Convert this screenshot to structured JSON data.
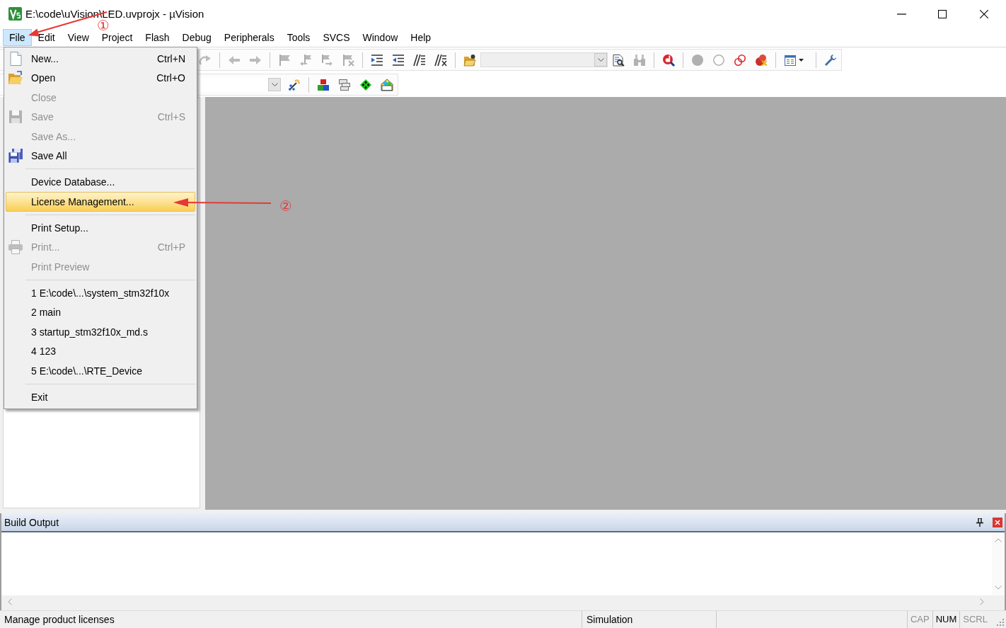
{
  "window": {
    "title": "E:\\code\\uVision\\LED.uvprojx - µVision"
  },
  "menu_bar": [
    {
      "label": "File",
      "selected": true
    },
    {
      "label": "Edit",
      "selected": false
    },
    {
      "label": "View",
      "selected": false
    },
    {
      "label": "Project",
      "selected": false
    },
    {
      "label": "Flash",
      "selected": false
    },
    {
      "label": "Debug",
      "selected": false
    },
    {
      "label": "Peripherals",
      "selected": false
    },
    {
      "label": "Tools",
      "selected": false
    },
    {
      "label": "SVCS",
      "selected": false
    },
    {
      "label": "Window",
      "selected": false
    },
    {
      "label": "Help",
      "selected": false
    }
  ],
  "toolbar_1": [
    {
      "kind": "button",
      "disabled": true
    },
    {
      "kind": "separator"
    },
    {
      "kind": "button",
      "disabled": true
    },
    {
      "kind": "button",
      "disabled": true
    },
    {
      "kind": "separator"
    },
    {
      "kind": "button",
      "disabled": true
    },
    {
      "kind": "button",
      "disabled": true
    },
    {
      "kind": "button",
      "disabled": true
    },
    {
      "kind": "button",
      "disabled": true
    },
    {
      "kind": "separator"
    },
    {
      "kind": "button",
      "disabled": false
    },
    {
      "kind": "button",
      "disabled": false
    },
    {
      "kind": "button",
      "disabled": false
    },
    {
      "kind": "button",
      "disabled": false
    },
    {
      "kind": "separator"
    },
    {
      "kind": "button",
      "disabled": false
    },
    {
      "kind": "combo",
      "disabled": true
    },
    {
      "kind": "button",
      "disabled": false
    },
    {
      "kind": "button",
      "disabled": true
    },
    {
      "kind": "separator"
    },
    {
      "kind": "button",
      "disabled": false
    },
    {
      "kind": "separator"
    },
    {
      "kind": "button",
      "disabled": true
    },
    {
      "kind": "button",
      "disabled": true
    },
    {
      "kind": "button",
      "disabled": false
    },
    {
      "kind": "button",
      "disabled": false
    },
    {
      "kind": "separator"
    },
    {
      "kind": "dropdown_button",
      "disabled": false
    },
    {
      "kind": "separator"
    },
    {
      "kind": "button",
      "disabled": false
    }
  ],
  "toolbar_2": [
    {
      "kind": "combo",
      "disabled": false
    },
    {
      "kind": "button",
      "disabled": false
    },
    {
      "kind": "separator"
    },
    {
      "kind": "button",
      "disabled": false
    },
    {
      "kind": "button",
      "disabled": false
    },
    {
      "kind": "button",
      "disabled": false
    },
    {
      "kind": "button",
      "disabled": false
    }
  ],
  "file_menu": {
    "items": [
      {
        "kind": "item",
        "label": "New...",
        "shortcut": "Ctrl+N",
        "disabled": false,
        "selected": false
      },
      {
        "kind": "item",
        "label": "Open",
        "shortcut": "Ctrl+O",
        "disabled": false,
        "selected": false
      },
      {
        "kind": "item",
        "label": "Close",
        "disabled": true,
        "selected": false
      },
      {
        "kind": "item",
        "label": "Save",
        "shortcut": "Ctrl+S",
        "disabled": true,
        "selected": false
      },
      {
        "kind": "item",
        "label": "Save As...",
        "disabled": true,
        "selected": false
      },
      {
        "kind": "item",
        "label": "Save All",
        "disabled": false,
        "selected": false
      },
      {
        "kind": "separator"
      },
      {
        "kind": "item",
        "label": "Device Database...",
        "disabled": false,
        "selected": false
      },
      {
        "kind": "item",
        "label": "License Management...",
        "disabled": false,
        "selected": true
      },
      {
        "kind": "separator"
      },
      {
        "kind": "item",
        "label": "Print Setup...",
        "disabled": false,
        "selected": false
      },
      {
        "kind": "item",
        "label": "Print...",
        "shortcut": "Ctrl+P",
        "disabled": true,
        "selected": false
      },
      {
        "kind": "item",
        "label": "Print Preview",
        "disabled": true,
        "selected": false
      },
      {
        "kind": "separator"
      },
      {
        "kind": "item",
        "label": "1 E:\\code\\...\\system_stm32f10x",
        "disabled": false,
        "selected": false
      },
      {
        "kind": "item",
        "label": "2 main",
        "disabled": false,
        "selected": false
      },
      {
        "kind": "item",
        "label": "3 startup_stm32f10x_md.s",
        "disabled": false,
        "selected": false
      },
      {
        "kind": "item",
        "label": "4 123",
        "disabled": false,
        "selected": false
      },
      {
        "kind": "item",
        "label": "5 E:\\code\\...\\RTE_Device",
        "disabled": false,
        "selected": false
      },
      {
        "kind": "separator"
      },
      {
        "kind": "item",
        "label": "Exit",
        "disabled": false,
        "selected": false
      }
    ]
  },
  "build_output": {
    "title": "Build Output"
  },
  "status_bar": {
    "message": "Manage product licenses",
    "mode": "Simulation",
    "indicators": [
      {
        "label": "CAP",
        "on": false
      },
      {
        "label": "NUM",
        "on": true
      },
      {
        "label": "SCRL",
        "on": false
      }
    ]
  },
  "annotations": [
    {
      "label": "①"
    },
    {
      "label": "②"
    }
  ]
}
